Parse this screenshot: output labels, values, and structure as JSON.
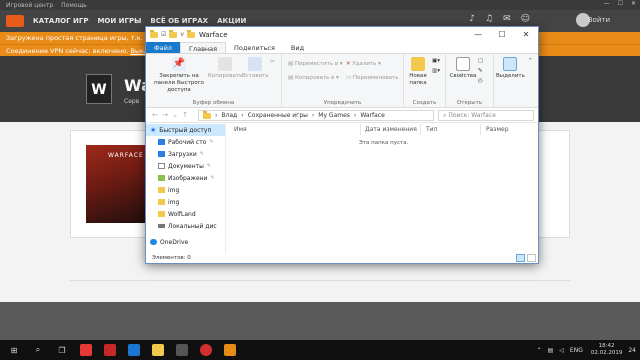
{
  "game_center": {
    "title": "Игровой центр",
    "help": "Помощь",
    "nav": [
      "КАТАЛОГ ИГР",
      "МОИ ИГРЫ",
      "ВСЁ ОБ ИГРАХ",
      "АКЦИИ"
    ],
    "username": "Войти",
    "banner1": "Загружена простая страница игры, т.к. отсутс",
    "banner2_prefix": "Соединение VPN сейчас: включено. ",
    "banner2_link": "Выключ",
    "game_title": "Wa",
    "game_sub": "Серв",
    "poster_text": "WARFACE"
  },
  "explorer": {
    "title": "Warface",
    "quick_access_hint": "v",
    "window_buttons": [
      "—",
      "☐",
      "✕"
    ],
    "tabs": {
      "file": "Файл",
      "home": "Главная",
      "share": "Поделиться",
      "view": "Вид"
    },
    "ribbon": {
      "pin_label": "Закрепить на панели быстрого доступа",
      "copy": "Копировать",
      "paste": "Вставить",
      "clipboard_group": "Буфер обмена",
      "move_to": "Переместить в",
      "copy_to": "Копировать в",
      "delete": "Удалить",
      "rename": "Переименовать",
      "organize_group": "Упорядочить",
      "new_folder": "Новая папка",
      "create_group": "Создать",
      "properties": "Свойства",
      "open_group": "Открыть",
      "select": "Выделить"
    },
    "address": {
      "crumbs": [
        "Влад",
        "Сохраненные игры",
        "My Games",
        "Warface"
      ]
    },
    "search_placeholder": "Поиск: Warface",
    "nav_pane": [
      {
        "label": "Быстрый доступ",
        "icon": "star-icon"
      },
      {
        "label": "Рабочий сто",
        "icon": "desktop-icon",
        "pinned": true
      },
      {
        "label": "Загрузки",
        "icon": "downloads-icon",
        "pinned": true
      },
      {
        "label": "Документы",
        "icon": "documents-icon",
        "pinned": true
      },
      {
        "label": "Изображени",
        "icon": "images-icon",
        "pinned": true
      },
      {
        "label": "img",
        "icon": "folder-icon"
      },
      {
        "label": "img",
        "icon": "folder-icon"
      },
      {
        "label": "WolfLand",
        "icon": "folder-icon"
      },
      {
        "label": "Локальный дис",
        "icon": "drive-icon"
      },
      {
        "label": "OneDrive",
        "icon": "onedrive-icon"
      }
    ],
    "columns": {
      "name": "Имя",
      "modified": "Дата изменения",
      "type": "Тип",
      "size": "Размер"
    },
    "empty_text": "Эта папка пуста.",
    "status": "Элементов: 0"
  },
  "taskbar": {
    "lang": "ENG",
    "time": "18:42",
    "date": "02.02.2019",
    "notif_count": "24"
  }
}
